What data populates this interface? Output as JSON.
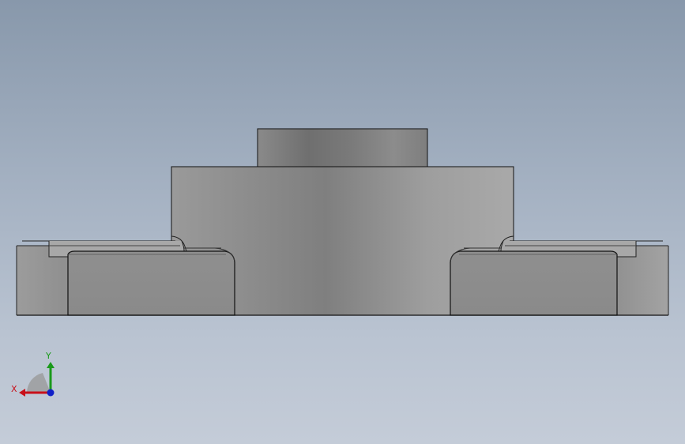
{
  "viewport": {
    "background_top": "#8898ab",
    "background_bottom": "#c4ccd8"
  },
  "model": {
    "view": "front",
    "edge_color": "#111111",
    "face_color_light": "#a6a6a6",
    "face_color_dark": "#7d7d7d"
  },
  "triad": {
    "x_label": "X",
    "y_label": "Y",
    "x_color": "#c8101a",
    "y_color": "#1a9a1a",
    "z_color": "#1020c8"
  }
}
